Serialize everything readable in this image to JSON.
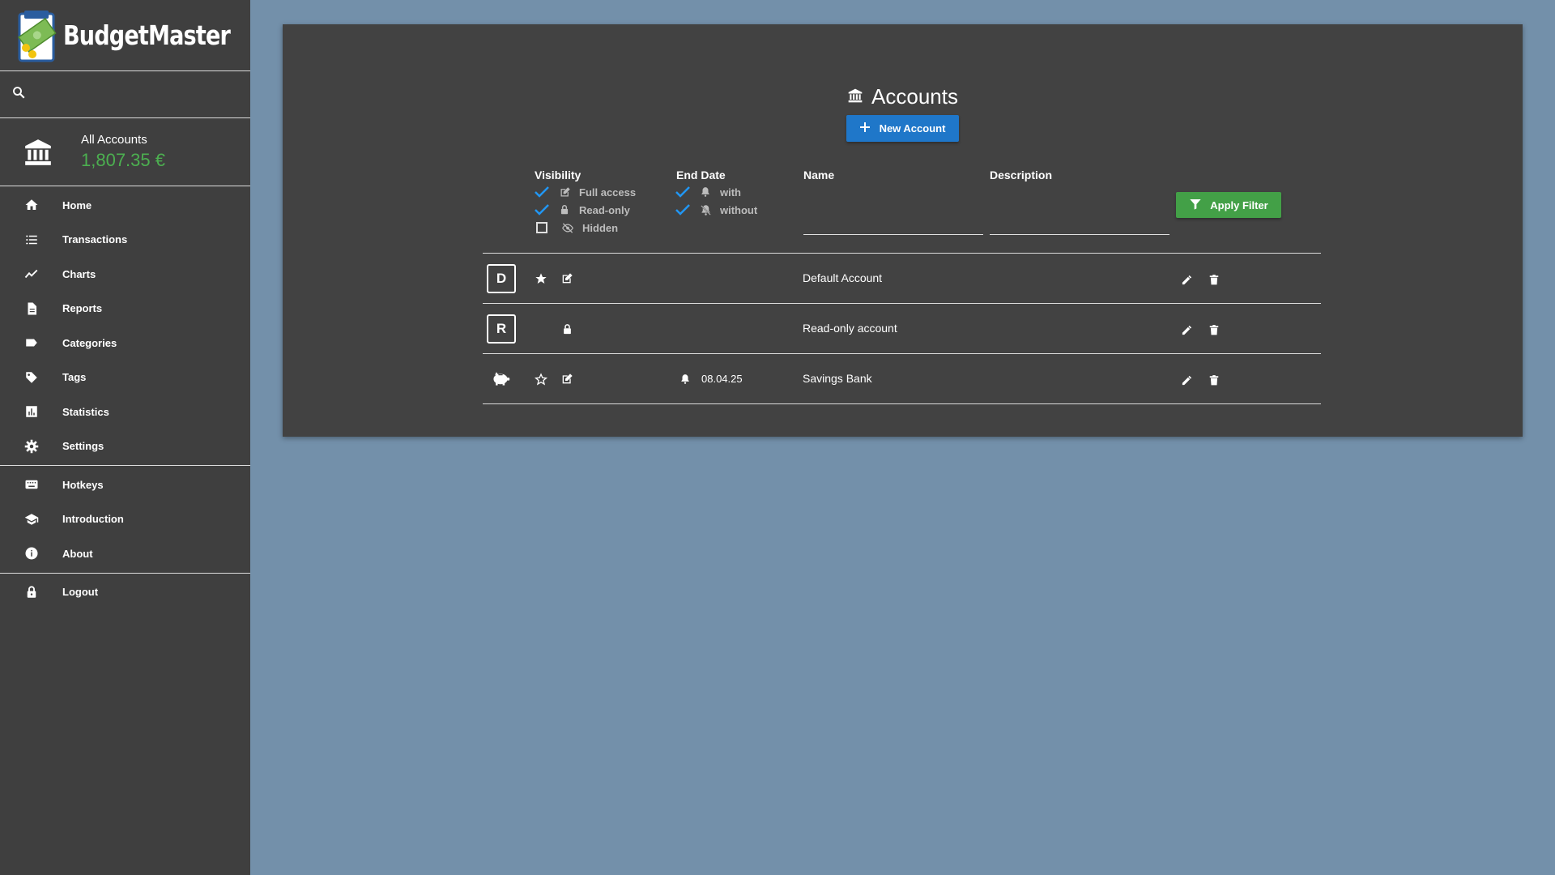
{
  "app": {
    "name": "BudgetMaster"
  },
  "sidebar": {
    "accounts_label": "All Accounts",
    "accounts_balance": "1,807.35 €",
    "groups": [
      [
        {
          "label": "Home",
          "icon": "home-icon"
        },
        {
          "label": "Transactions",
          "icon": "list-icon"
        },
        {
          "label": "Charts",
          "icon": "chart-line-icon"
        },
        {
          "label": "Reports",
          "icon": "document-icon"
        },
        {
          "label": "Categories",
          "icon": "label-icon"
        },
        {
          "label": "Tags",
          "icon": "tag-icon"
        },
        {
          "label": "Statistics",
          "icon": "bar-chart-icon"
        },
        {
          "label": "Settings",
          "icon": "gear-icon"
        }
      ],
      [
        {
          "label": "Hotkeys",
          "icon": "keyboard-icon"
        },
        {
          "label": "Introduction",
          "icon": "graduation-cap-icon"
        },
        {
          "label": "About",
          "icon": "info-icon"
        }
      ],
      [
        {
          "label": "Logout",
          "icon": "lock-icon"
        }
      ]
    ]
  },
  "main": {
    "title": "Accounts",
    "new_button": "New Account",
    "filter": {
      "visibility_label": "Visibility",
      "visibility_options": [
        {
          "label": "Full access",
          "checked": true
        },
        {
          "label": "Read-only",
          "checked": true
        },
        {
          "label": "Hidden",
          "checked": false
        }
      ],
      "end_date_label": "End Date",
      "end_date_options": [
        {
          "label": "with",
          "checked": true
        },
        {
          "label": "without",
          "checked": true
        }
      ],
      "name_label": "Name",
      "name_value": "",
      "description_label": "Description",
      "description_value": "",
      "apply_button": "Apply Filter"
    },
    "accounts": [
      {
        "avatar": "D",
        "favorite": true,
        "state": "full-access",
        "end_date": "",
        "name": "Default Account"
      },
      {
        "avatar": "R",
        "favorite": false,
        "state": "read-only",
        "end_date": "",
        "name": "Read-only account"
      },
      {
        "avatar": "",
        "avatar_icon": "piggy-bank-icon",
        "favorite": false,
        "state": "full-access",
        "end_date": "08.04.25",
        "name": "Savings Bank"
      }
    ]
  },
  "colors": {
    "sidebar_bg": "#3f3f3f",
    "page_bg": "#7390aa",
    "card_bg": "#424242",
    "primary_blue": "#1f77c9",
    "apply_green": "#43a047",
    "balance_green": "#4caf50",
    "check_blue": "#2196f3"
  }
}
